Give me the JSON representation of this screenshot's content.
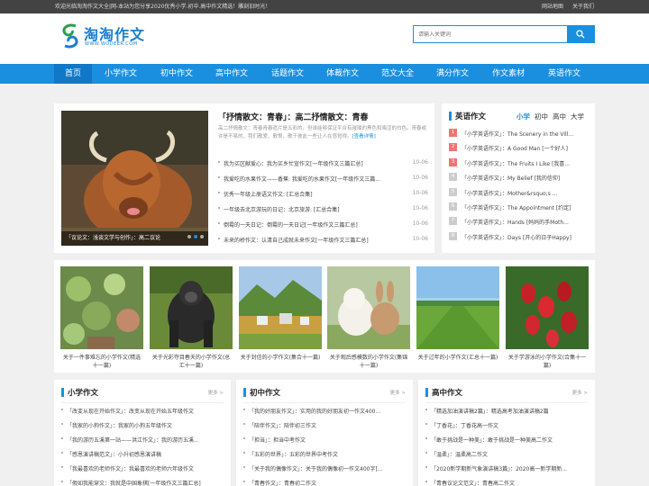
{
  "topbar": {
    "welcome": "欢迎光临淘淘作文大全|网-本站为您分享2020优秀小学.初中.高中作文精选！雕刻旧时光！",
    "links": [
      "网站地图",
      "关于我们"
    ]
  },
  "logo": {
    "name": "淘淘作文",
    "url": "WWW.WODEER.COM"
  },
  "search": {
    "placeholder": "请输入关键词"
  },
  "nav": [
    "首页",
    "小学作文",
    "初中作文",
    "高中作文",
    "话题作文",
    "体裁作文",
    "范文大全",
    "满分作文",
    "作文素材",
    "英语作文"
  ],
  "featured": {
    "caption": "「议论文：浅谈文学与创作」：高二议论",
    "title": "「抒情散文：青春」：高二抒情散文：青春",
    "desc": "高二抒情散文：青春青春遗片是五彩的，但谁能够保证平合有璀璨的黑色和晦涩的白色。青春或许是不易的，我们散爱、散恨，散于彼此一些让人在感觉得。",
    "more": "[查看详情]",
    "list": [
      {
        "title": "我为买区献爱心：我为买乡忙宣作文[一年级作文三篇汇总]",
        "date": "10-06"
      },
      {
        "title": "我爱吃的水果作文——香蕉: 我爱吃的水果作文[一年级作文三篇...",
        "date": "10-06"
      },
      {
        "title": "优秀一年级上册语文作文: [汇总合集]",
        "date": "10-06"
      },
      {
        "title": "一年级去北京游玩的日记：北京旅游: [汇总合集]",
        "date": "10-06"
      },
      {
        "title": "倒霉的一天日记：倒霉的一天日记[一年级作文三篇汇总]",
        "date": "10-06"
      },
      {
        "title": "未来的桥作文：认清自己成就未来作文[一年级作文三篇汇总]",
        "date": "10-06"
      }
    ]
  },
  "english": {
    "title": "英语作文",
    "tabs": [
      "小学",
      "初中",
      "高中",
      "大学"
    ],
    "items": [
      {
        "num": "1",
        "title": "「小学英语作文」：The Scenery in the Vill..."
      },
      {
        "num": "2",
        "title": "「小学英语作文」：A Good Man [一个好人]"
      },
      {
        "num": "3",
        "title": "「小学英语作文」：The Fruits I Like [我喜..."
      },
      {
        "num": "4",
        "title": "「小学英语作文」：My Belief [我的信仰]"
      },
      {
        "num": "5",
        "title": "「小学英语作文」：Mother&rsquo;s ..."
      },
      {
        "num": "6",
        "title": "「小学英语作文」：The Appointment [约定]"
      },
      {
        "num": "7",
        "title": "「小学英语作文」：Hands [妈妈的手Moth..."
      },
      {
        "num": "8",
        "title": "「小学英语作文」：Days [开心的日子Happy]"
      }
    ]
  },
  "gallery": [
    {
      "caption": "关于一件事难忘的小学作文(精选十一篇)"
    },
    {
      "caption": "关于光彩夺目春天的小学作文(总汇十一篇)"
    },
    {
      "caption": "关于封信的小学作文(集合十一篇)"
    },
    {
      "caption": "关于观后感模数的小学作文(集锦十一篇)"
    },
    {
      "caption": "关于过年的小学作文(汇总十一篇)"
    },
    {
      "caption": "关于学游泳的小学作文(合集十一篇)"
    }
  ],
  "columns": [
    {
      "title": "小学作文",
      "more": "更多 >",
      "items": [
        "「改変从现在开始作文」：改变从现在开始五年级作文",
        "「我家的小狗作文」：我家的小狗五年级作文",
        "「我的游历五溪第一站——洪江作文」：我的游历五溪...",
        "「感恩演讲稿范文」：小升初感恩演讲稿",
        "「我最喜欢的老师作文」：我最喜欢的老师六年级作文",
        "「假如我能穿文：我就是中国象棋[一年级作文三篇汇总]"
      ]
    },
    {
      "title": "初中作文",
      "more": "更多 >",
      "items": [
        "「我的好朋友作文」：实用的我的好朋友初一作文400...",
        "「陪伴作文」：陪伴初三作文",
        "「担当」：担当中考作文",
        "「五彩的世界」：五彩的世界中考作文",
        "「关于我的偶像作文」：关于我的偶像初一作文400字[...",
        "「青春作文」：青春初二作文"
      ]
    },
    {
      "title": "高中作文",
      "more": "更多 >",
      "items": [
        "「精选加油演讲稿2篇」：精选高考加油演讲稿2篇",
        "「丁香花」：丁香花高一作文",
        "「敢于挑战是一种美」：敢于挑战是一种美高二作文",
        "「温柔」：温柔高二作文",
        "「2020新学期新气象演讲稿3篇」：2020高一新学期新...",
        "「青春议论文范文」：青春高二作文"
      ]
    }
  ]
}
